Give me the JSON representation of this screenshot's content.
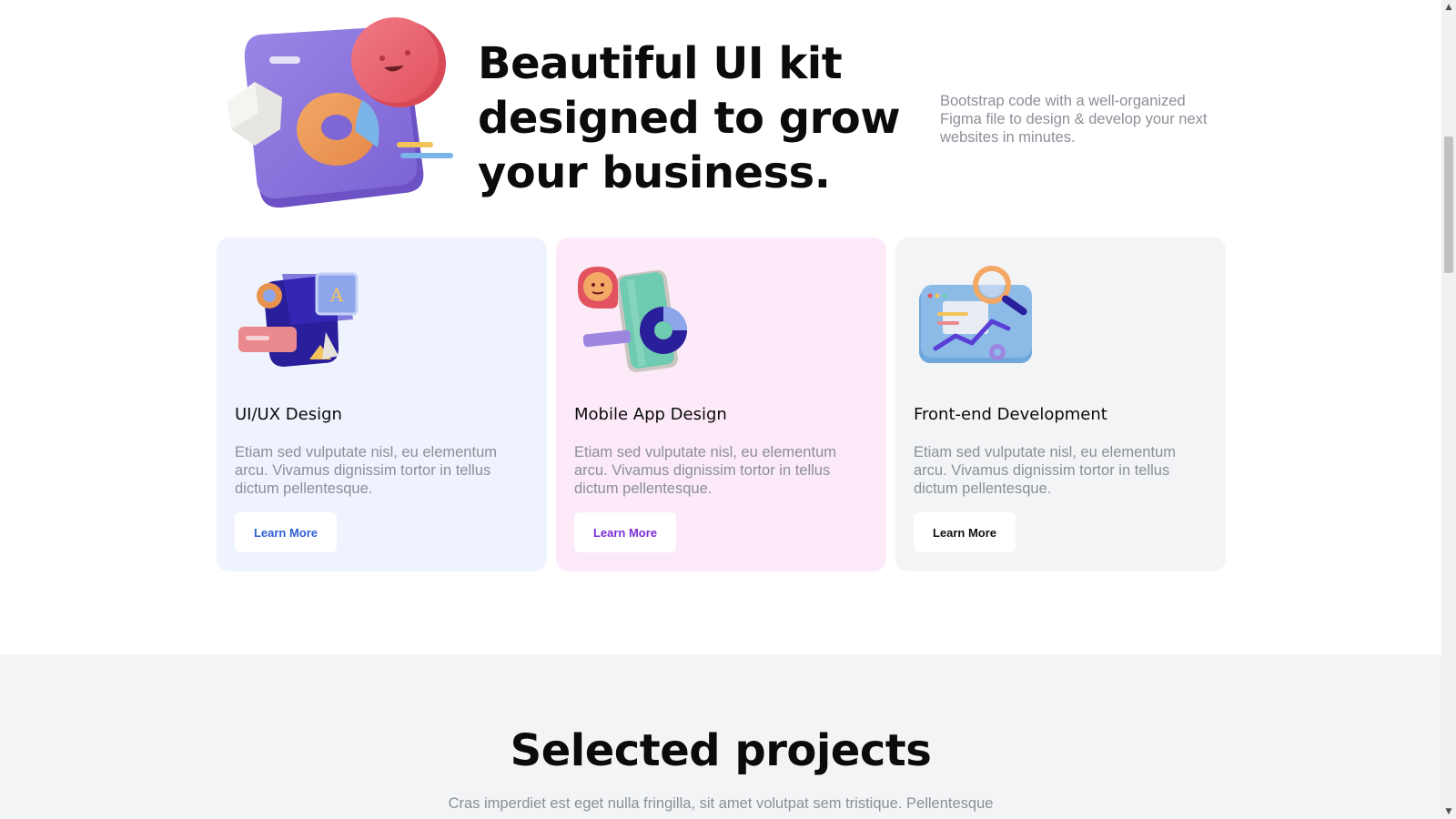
{
  "hero": {
    "title": "Beautiful UI kit designed to grow your business.",
    "description": "Bootstrap code with a well-organized Figma file to design & develop your next websites in minutes.",
    "illustration": "analytics-3d-illustration"
  },
  "cards": [
    {
      "title": "UI/UX Design",
      "text": "Etiam sed vulputate nisl, eu elementum arcu. Vivamus dignissim tortor in tellus dictum pellentesque.",
      "button": "Learn More",
      "illustration": "design-shapes-illustration",
      "background": "#eff3fd",
      "accent": "#2f5fd6"
    },
    {
      "title": "Mobile App Design",
      "text": "Etiam sed vulputate nisl, eu elementum arcu. Vivamus dignissim tortor in tellus dictum pellentesque.",
      "button": "Learn More",
      "illustration": "mobile-phone-illustration",
      "background": "#fceaf8",
      "accent": "#7b2fd6"
    },
    {
      "title": "Front-end Development",
      "text": "Etiam sed vulputate nisl, eu elementum arcu. Vivamus dignissim tortor in tellus dictum pellentesque.",
      "button": "Learn More",
      "illustration": "browser-chart-illustration",
      "background": "#f3f4f6",
      "accent": "#111111"
    }
  ],
  "projects": {
    "title": "Selected projects",
    "description": "Cras imperdiet est eget nulla fringilla, sit amet volutpat sem tristique. Pellentesque"
  },
  "scrollbar": {
    "up_icon": "▲",
    "down_icon": "▼"
  }
}
